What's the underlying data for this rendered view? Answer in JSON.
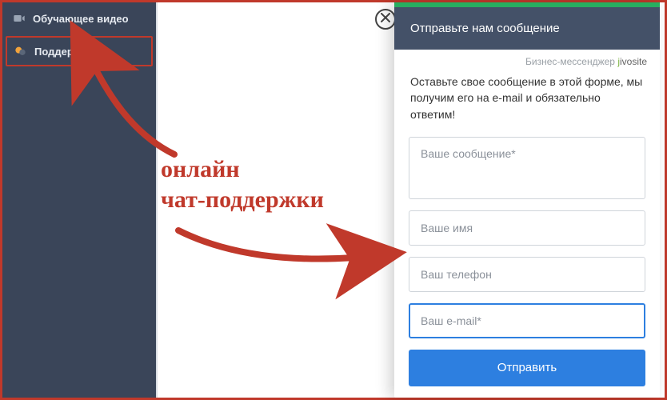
{
  "sidebar": {
    "items": [
      {
        "label": "Обучающее видео",
        "icon": "video-icon"
      },
      {
        "label": "Поддержка",
        "icon": "chat-bubbles-icon"
      }
    ]
  },
  "chat": {
    "header": "Отправьте нам сообщение",
    "brand_prefix": "Бизнес-мессенджер ",
    "brand_name": "jivosite",
    "description": "Оставьте свое сообщение в этой форме, мы получим его на e-mail и обязательно ответим!",
    "placeholders": {
      "message": "Ваше сообщение*",
      "name": "Ваше имя",
      "phone": "Ваш телефон",
      "email": "Ваш e-mail*"
    },
    "send_label": "Отправить"
  },
  "annotation": {
    "line1": "онлайн",
    "line2": "чат-поддержки"
  },
  "colors": {
    "frame_border": "#c0392b",
    "sidebar_bg": "#3a4559",
    "chat_header_bg": "#445168",
    "accent_blue": "#2d7fe0",
    "accent_green": "#27ae60"
  }
}
